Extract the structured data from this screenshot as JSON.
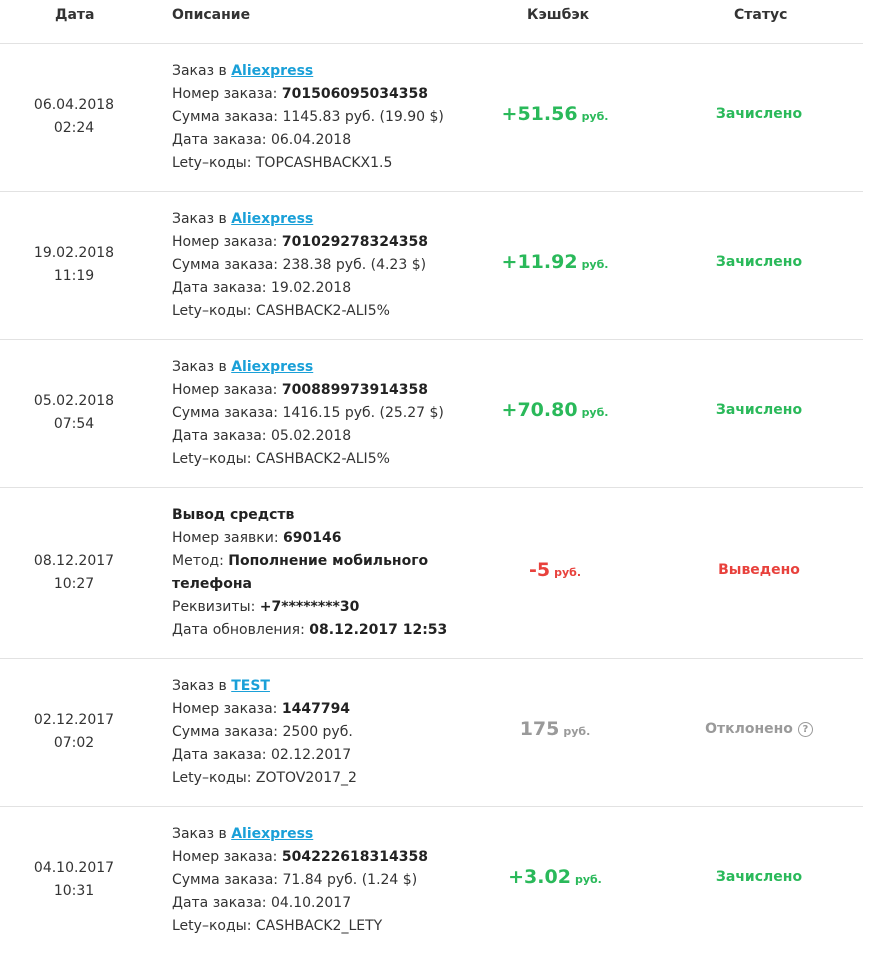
{
  "header": {
    "date": "Дата",
    "description": "Описание",
    "cashback": "Кэшбэк",
    "status": "Статус"
  },
  "labels": {
    "order_in": "Заказ в",
    "order_number": "Номер заказа:",
    "order_sum": "Сумма заказа:",
    "order_date": "Дата заказа:",
    "lety_codes": "Lety–коды:",
    "withdrawal_title": "Вывод средств",
    "request_number": "Номер заявки:",
    "method": "Метод:",
    "requisites": "Реквизиты:",
    "update_date": "Дата обновления:",
    "currency": "руб."
  },
  "rows": [
    {
      "date": "06.04.2018",
      "time": "02:24",
      "shop": "Aliexpress",
      "order_number": "701506095034358",
      "sum": "1145.83 руб. (19.90 $)",
      "order_date": "06.04.2018",
      "codes": "TOPCASHBACKX1.5",
      "amount": "+51.56",
      "status": "Зачислено"
    },
    {
      "date": "19.02.2018",
      "time": "11:19",
      "shop": "Aliexpress",
      "order_number": "701029278324358",
      "sum": "238.38 руб. (4.23 $)",
      "order_date": "19.02.2018",
      "codes": "CASHBACK2-ALI5%",
      "amount": "+11.92",
      "status": "Зачислено"
    },
    {
      "date": "05.02.2018",
      "time": "07:54",
      "shop": "Aliexpress",
      "order_number": "700889973914358",
      "sum": "1416.15 руб. (25.27 $)",
      "order_date": "05.02.2018",
      "codes": "CASHBACK2-ALI5%",
      "amount": "+70.80",
      "status": "Зачислено"
    },
    {
      "date": "08.12.2017",
      "time": "10:27",
      "request_number": "690146",
      "method_line1": "Пополнение мобильного",
      "method_line2": "телефона",
      "requisites": "+7********30",
      "update_date": "08.12.2017 12:53",
      "amount": "-5",
      "status": "Выведено"
    },
    {
      "date": "02.12.2017",
      "time": "07:02",
      "shop": "TEST",
      "order_number": "1447794",
      "sum": "2500 руб.",
      "order_date": "02.12.2017",
      "codes": "ZOTOV2017_2",
      "amount": "175",
      "status": "Отклонено",
      "help_icon": "?"
    },
    {
      "date": "04.10.2017",
      "time": "10:31",
      "shop": "Aliexpress",
      "order_number": "504222618314358",
      "sum": "71.84 руб. (1.24 $)",
      "order_date": "04.10.2017",
      "codes": "CASHBACK2_LETY",
      "amount": "+3.02",
      "status": "Зачислено"
    }
  ],
  "colors": {
    "credited": "#2ab95a",
    "withdrawn": "#e8413c",
    "rejected": "#9a9a9a",
    "link": "#1aa0d8",
    "divider": "#e2e2e2"
  }
}
